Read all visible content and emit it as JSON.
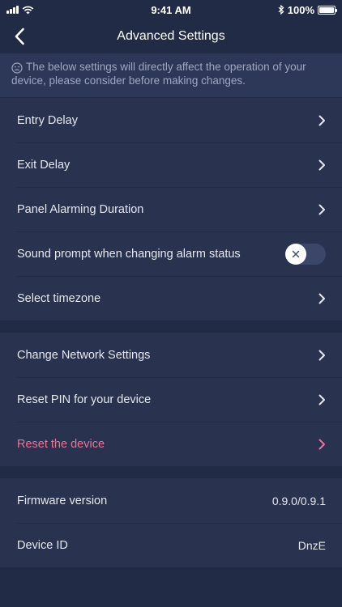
{
  "status_bar": {
    "time": "9:41 AM",
    "battery": "100%"
  },
  "nav": {
    "title": "Advanced Settings"
  },
  "notice": {
    "text": "The below settings will directly affect the operation of your device, please consider before making changes."
  },
  "group1": [
    {
      "label": "Entry Delay"
    },
    {
      "label": "Exit Delay"
    },
    {
      "label": "Panel Alarming Duration"
    },
    {
      "label": "Sound prompt when changing alarm status",
      "toggle": false
    },
    {
      "label": "Select timezone"
    }
  ],
  "group2": [
    {
      "label": "Change Network Settings"
    },
    {
      "label": "Reset PIN for your device"
    },
    {
      "label": "Reset the device"
    }
  ],
  "group3": [
    {
      "label": "Firmware version",
      "value": "0.9.0/0.9.1"
    },
    {
      "label": "Device ID",
      "value": "DnzE"
    }
  ],
  "colors": {
    "background": "#222b45",
    "row": "#29324f",
    "danger": "#e8749a",
    "notice_bg": "#2d3858"
  }
}
